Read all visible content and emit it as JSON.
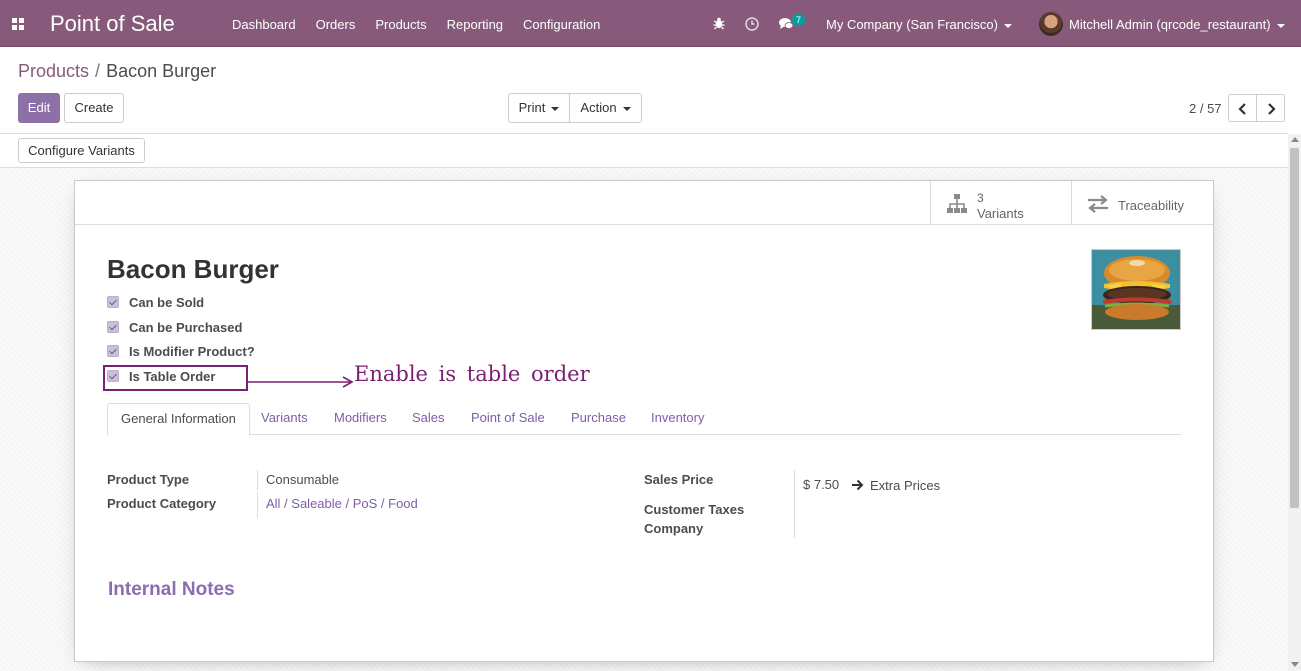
{
  "navbar": {
    "brand": "Point of Sale",
    "menu": [
      "Dashboard",
      "Orders",
      "Products",
      "Reporting",
      "Configuration"
    ],
    "chat_badge": "7",
    "company": "My Company (San Francisco)",
    "user": "Mitchell Admin (qrcode_restaurant)"
  },
  "breadcrumb": {
    "parent": "Products",
    "separator": "/",
    "current": "Bacon Burger"
  },
  "controls": {
    "edit": "Edit",
    "create": "Create",
    "print": "Print",
    "action": "Action",
    "pager": "2 / 57",
    "configure_variants": "Configure Variants"
  },
  "smart_buttons": {
    "variants_count": "3",
    "variants_label": "Variants",
    "traceability_label": "Traceability"
  },
  "product": {
    "name": "Bacon Burger",
    "checkboxes": [
      {
        "label": "Can be Sold",
        "checked": true
      },
      {
        "label": "Can be Purchased",
        "checked": true
      },
      {
        "label": "Is Modifier Product?",
        "checked": true
      },
      {
        "label": "Is Table Order",
        "checked": true
      }
    ]
  },
  "annotation": {
    "text": "Enable is table order",
    "color": "#7b1f73"
  },
  "tabs": [
    "General Information",
    "Variants",
    "Modifiers",
    "Sales",
    "Point of Sale",
    "Purchase",
    "Inventory"
  ],
  "general_info": {
    "product_type_label": "Product Type",
    "product_type_value": "Consumable",
    "product_category_label": "Product Category",
    "product_category_value": "All / Saleable / PoS / Food",
    "sales_price_label": "Sales Price",
    "sales_price_value": "$ 7.50",
    "extra_prices": "Extra Prices",
    "customer_taxes_label": "Customer Taxes",
    "company_label": "Company"
  },
  "internal_notes_title": "Internal Notes",
  "colors": {
    "brand": "#875a7b",
    "accent": "#8e70a8",
    "link": "#7c5fa6"
  }
}
